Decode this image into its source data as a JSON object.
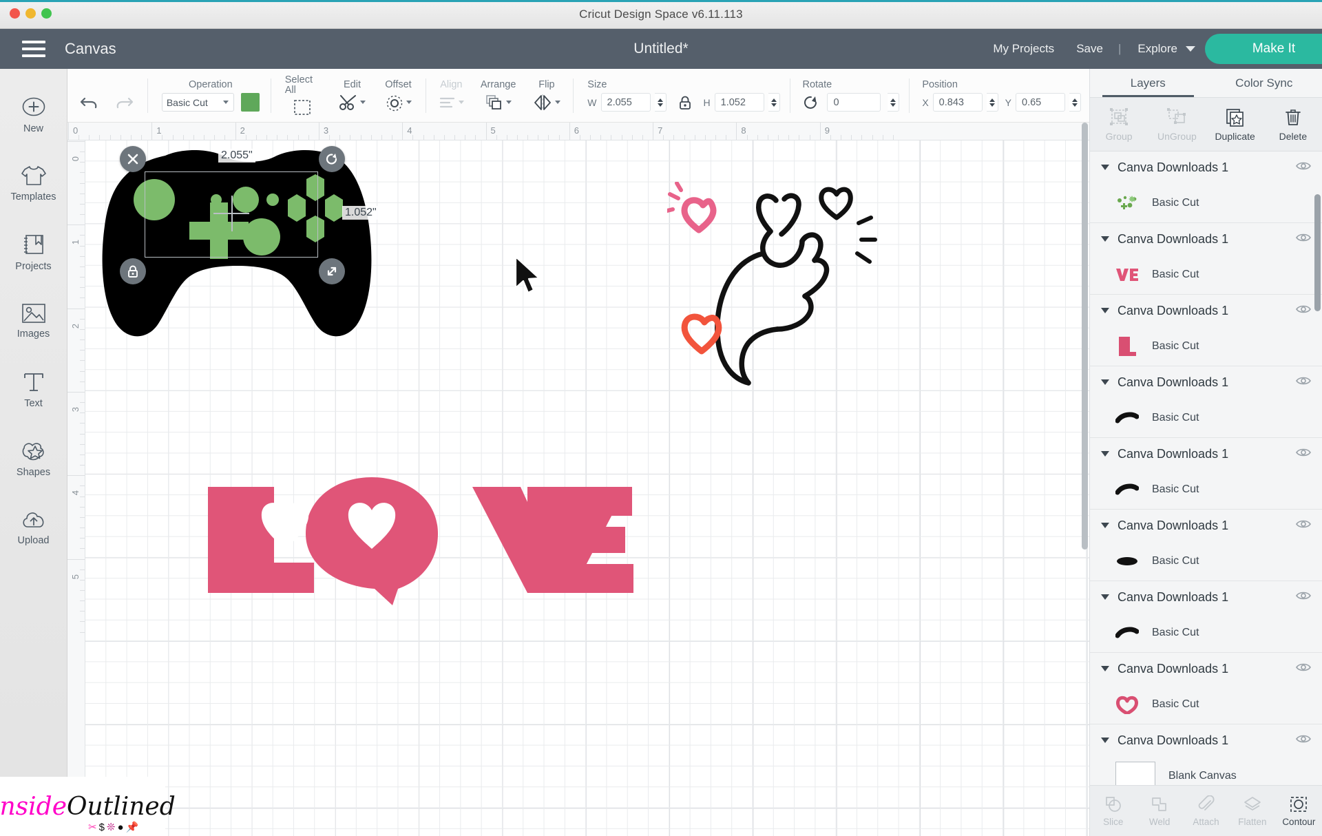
{
  "window": {
    "title": "Cricut Design Space  v6.11.113"
  },
  "header": {
    "canvas_label": "Canvas",
    "document_title": "Untitled*",
    "my_projects": "My Projects",
    "save": "Save",
    "separator": "|",
    "explore": "Explore",
    "make_it": "Make It"
  },
  "sidebar": {
    "items": [
      {
        "label": "New",
        "icon": "plus-circle-icon"
      },
      {
        "label": "Templates",
        "icon": "tshirt-icon"
      },
      {
        "label": "Projects",
        "icon": "book-icon"
      },
      {
        "label": "Images",
        "icon": "picture-icon"
      },
      {
        "label": "Text",
        "icon": "text-t-icon"
      },
      {
        "label": "Shapes",
        "icon": "shapes-icon"
      },
      {
        "label": "Upload",
        "icon": "upload-cloud-icon"
      }
    ]
  },
  "toolbar": {
    "undo": "undo-icon",
    "redo": "redo-icon",
    "operation_label": "Operation",
    "operation_value": "Basic Cut",
    "operation_color": "#5fa85a",
    "select_all_label": "Select All",
    "edit_label": "Edit",
    "offset_label": "Offset",
    "align_label": "Align",
    "arrange_label": "Arrange",
    "flip_label": "Flip",
    "size_label": "Size",
    "size_w_label": "W",
    "size_w_value": "2.055",
    "size_h_label": "H",
    "size_h_value": "1.052",
    "lock_icon": "lock-icon",
    "rotate_label": "Rotate",
    "rotate_value": "0",
    "position_label": "Position",
    "position_x_label": "X",
    "position_x_value": "0.843",
    "position_y_label": "Y",
    "position_y_value": "0.65"
  },
  "rulers": {
    "top": [
      "0",
      "1",
      "2",
      "3",
      "4",
      "5",
      "6",
      "7",
      "8",
      "9"
    ],
    "left": [
      "0",
      "1",
      "2",
      "3",
      "4",
      "5"
    ]
  },
  "canvas": {
    "selection": {
      "width_label": "2.055\"",
      "height_label": "1.052\"",
      "delete_icon": "close-x-icon",
      "rotate_icon": "rotate-icon",
      "lock_icon": "lock-closed-icon",
      "resize_icon": "resize-diagonal-icon"
    },
    "artwork": {
      "controller_body_color": "#000000",
      "controller_button_color": "#7cbb6b",
      "love_text": "LOVE",
      "love_color": "#e05578",
      "heart_pink": "#e8638a",
      "heart_red": "#f2543c",
      "line_art_color": "#111111"
    }
  },
  "right_panel": {
    "tabs": [
      {
        "label": "Layers",
        "active": true
      },
      {
        "label": "Color Sync",
        "active": false
      }
    ],
    "actions": [
      {
        "label": "Group",
        "icon": "group-icon",
        "enabled": false
      },
      {
        "label": "UnGroup",
        "icon": "ungroup-icon",
        "enabled": false
      },
      {
        "label": "Duplicate",
        "icon": "duplicate-icon",
        "enabled": true
      },
      {
        "label": "Delete",
        "icon": "trash-icon",
        "enabled": true
      }
    ],
    "groups": [
      {
        "name": "Canva Downloads 1",
        "layer_type": "Basic Cut",
        "thumb": "green-confetti-thumb"
      },
      {
        "name": "Canva Downloads 1",
        "layer_type": "Basic Cut",
        "thumb": "ve-letters-thumb"
      },
      {
        "name": "Canva Downloads 1",
        "layer_type": "Basic Cut",
        "thumb": "l-letter-thumb"
      },
      {
        "name": "Canva Downloads 1",
        "layer_type": "Basic Cut",
        "thumb": "black-stroke-thumb"
      },
      {
        "name": "Canva Downloads 1",
        "layer_type": "Basic Cut",
        "thumb": "black-stroke-thumb"
      },
      {
        "name": "Canva Downloads 1",
        "layer_type": "Basic Cut",
        "thumb": "black-oval-thumb"
      },
      {
        "name": "Canva Downloads 1",
        "layer_type": "Basic Cut",
        "thumb": "black-stroke-thumb"
      },
      {
        "name": "Canva Downloads 1",
        "layer_type": "Basic Cut",
        "thumb": "pink-heart-thumb"
      },
      {
        "name": "Canva Downloads 1",
        "layer_type": "Blank Canvas",
        "thumb": "blank-canvas-thumb"
      }
    ],
    "bottom_actions": [
      {
        "label": "Slice",
        "icon": "slice-icon",
        "enabled": false
      },
      {
        "label": "Weld",
        "icon": "weld-icon",
        "enabled": false
      },
      {
        "label": "Attach",
        "icon": "attach-paperclip-icon",
        "enabled": false
      },
      {
        "label": "Flatten",
        "icon": "flatten-icon",
        "enabled": false
      },
      {
        "label": "Contour",
        "icon": "contour-icon",
        "enabled": true
      }
    ]
  },
  "watermark": {
    "text_1": "Inside",
    "text_2": "Outlined"
  }
}
